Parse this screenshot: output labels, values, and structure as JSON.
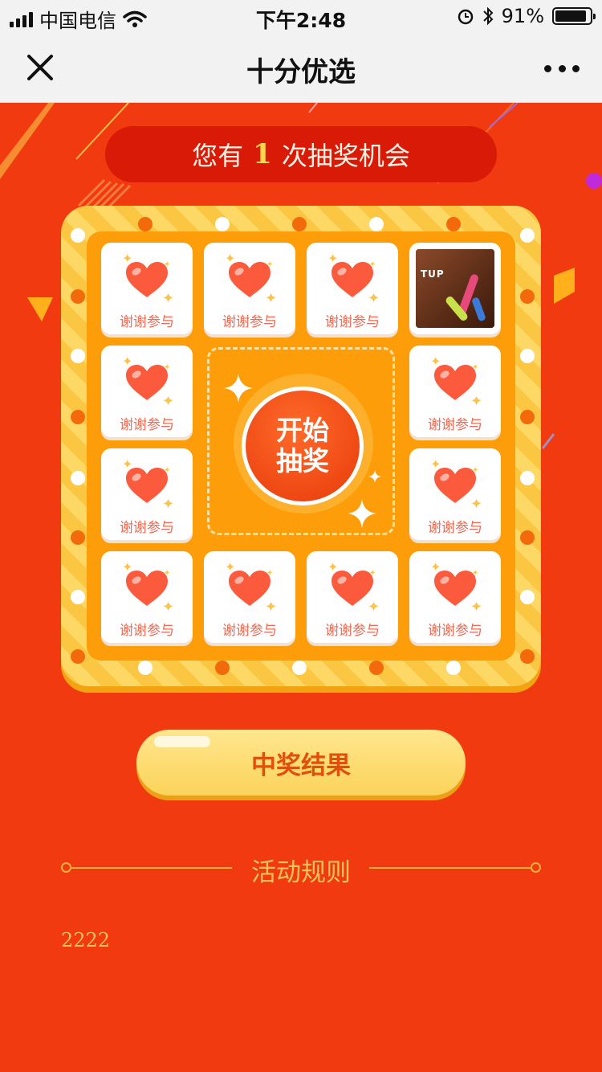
{
  "status_bar": {
    "carrier": "中国电信",
    "time": "下午2:48",
    "battery_percent": "91%",
    "battery_level": 0.91
  },
  "nav": {
    "title": "十分优选",
    "close_icon": "close-icon",
    "more_icon": "more-icon"
  },
  "chance": {
    "prefix": "您有",
    "count": "1",
    "suffix": "次抽奖机会"
  },
  "prizes": [
    {
      "label": "谢谢参与"
    },
    {
      "label": "谢谢参与"
    },
    {
      "label": "谢谢参与"
    },
    {
      "label": "",
      "image": true,
      "brand": "TUP"
    },
    {
      "label": "谢谢参与"
    },
    {
      "label": "谢谢参与"
    },
    {
      "label": "谢谢参与"
    },
    {
      "label": "谢谢参与"
    },
    {
      "label": "谢谢参与"
    },
    {
      "label": "谢谢参与"
    },
    {
      "label": "谢谢参与"
    },
    {
      "label": "谢谢参与"
    }
  ],
  "start_button": {
    "line1": "开始",
    "line2": "抽奖"
  },
  "result_button": {
    "label": "中奖结果"
  },
  "rules": {
    "title": "活动规则",
    "content": "2222"
  },
  "colors": {
    "background": "#f13a10",
    "banner": "#d91a06",
    "accent_yellow": "#ffd84a",
    "heart": "#fb5a3c"
  }
}
